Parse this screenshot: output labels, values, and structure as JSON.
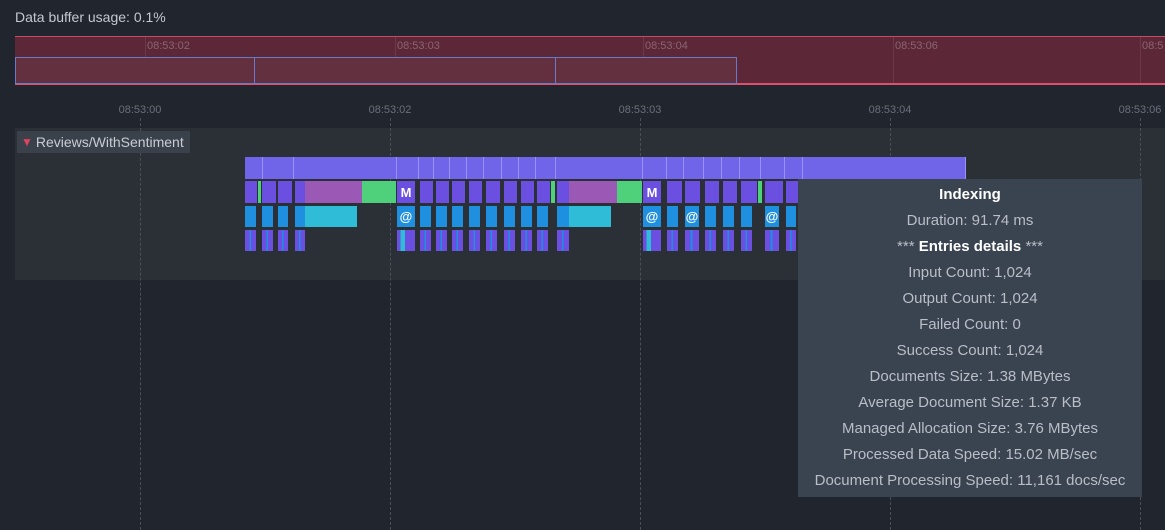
{
  "buffer_label": "Data buffer usage: 0.1%",
  "overview_ticks": [
    "08:53:02",
    "08:53:03",
    "08:53:04",
    "08:53:06",
    "08:5"
  ],
  "axis_ticks": [
    "08:53:00",
    "08:53:02",
    "08:53:03",
    "08:53:04",
    "08:53:06"
  ],
  "track": {
    "name": "Reviews/WithSentiment",
    "marker_m": "M",
    "marker_at": "@"
  },
  "tooltip": {
    "title": "Indexing",
    "duration": "Duration: 91.74 ms",
    "entries_prefix": "***",
    "entries_label": "Entries details",
    "entries_suffix": "***",
    "input_count": "Input Count: 1,024",
    "output_count": "Output Count: 1,024",
    "failed_count": "Failed Count: 0",
    "success_count": "Success Count: 1,024",
    "documents_size": "Documents Size: 1.38 MBytes",
    "avg_doc_size": "Average Document Size: 1.37 KB",
    "managed_alloc": "Managed Allocation Size: 3.76 MBytes",
    "processed_speed": "Processed Data Speed: 15.02 MB/sec",
    "doc_speed": "Document Processing Speed: 11,161 docs/sec"
  },
  "colors": {
    "background": "#21252e",
    "overview": "#5c2838",
    "indexing_bar": "#7065e8",
    "map_bar": "#9b59b6",
    "green_bar": "#4fd07a",
    "cyan_bar": "#2ebcd6",
    "blue_bar": "#1f8fe0"
  }
}
